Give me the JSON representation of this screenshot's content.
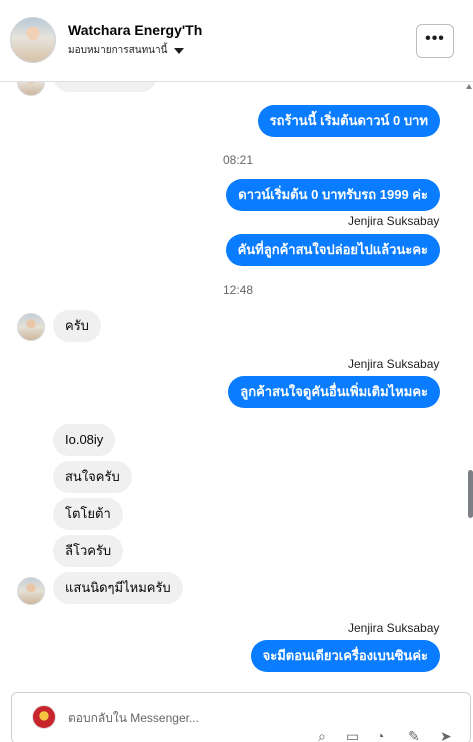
{
  "header": {
    "name": "Watchara Energy'Th",
    "assign_label": "มอบหมายการสนทนานี้",
    "more_label": "•••"
  },
  "thread": {
    "time_1": "08:21",
    "time_2": "12:48",
    "agent_name": "Jenjira Suksabay",
    "messages": {
      "m1": "รถร้านนี้ เริ่มต้นดาวน์ 0 บาท",
      "m2": "ดาวน์เริ่มต้น 0 บาทรับรถ 1999 ค่ะ",
      "m3": "คันที่ลูกค้าสนใจปล่อยไปแล้วนะคะ",
      "m4": "ครับ",
      "m5": "ลูกค้าสนใจดูคันอื่นเพิ่มเติมไหมคะ",
      "m6": "Io.08iy",
      "m7": "สนใจครับ",
      "m8": "โตโยต้า",
      "m9": "ลีโวครับ",
      "m10": "แสนนิดๆมีไหมครับ",
      "m11": "จะมีตอนเดียวเครื่องเบนซินค่ะ"
    }
  },
  "composer": {
    "placeholder": "ตอบกลับใน Messenger..."
  }
}
